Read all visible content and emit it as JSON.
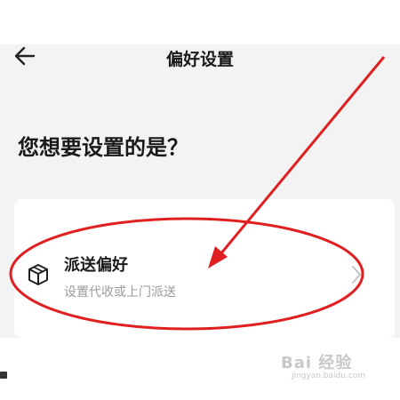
{
  "header": {
    "back_icon": "arrow-left-icon",
    "title": "偏好设置"
  },
  "main": {
    "question": "您想要设置的是？",
    "options": [
      {
        "icon": "box-icon",
        "title": "派送偏好",
        "subtitle": "设置代收或上门派送",
        "chevron_icon": "chevron-right-icon"
      }
    ]
  },
  "annotation": {
    "color": "#e02020",
    "shape": "ellipse-and-arrow"
  },
  "watermark": {
    "brand": "Bai 经验",
    "url": "jingyan.baidu.com"
  }
}
